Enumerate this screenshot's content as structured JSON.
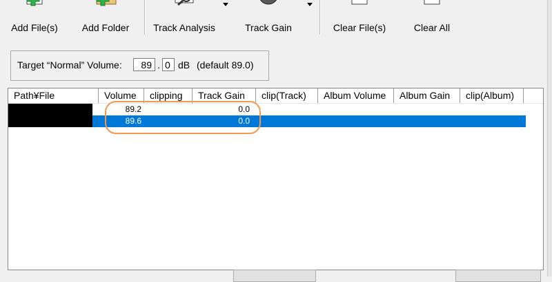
{
  "toolbar": {
    "buttons": [
      {
        "label": "Add File(s)",
        "icon": "add-file-icon"
      },
      {
        "label": "Add Folder",
        "icon": "add-folder-icon"
      },
      {
        "label": "Track Analysis",
        "icon": "analysis-magnifier-icon"
      },
      {
        "label": "Track Gain",
        "icon": "gain-speaker-icon"
      },
      {
        "label": "Clear File(s)",
        "icon": "clear-file-icon"
      },
      {
        "label": "Clear All",
        "icon": "clear-all-icon"
      }
    ]
  },
  "target": {
    "label": "Target “Normal” Volume:",
    "value_int": "89",
    "dot": ".",
    "value_dec": "0",
    "unit": "dB",
    "default": "(default 89.0)"
  },
  "list": {
    "columns": [
      "Path¥File",
      "Volume",
      "clipping",
      "Track Gain",
      "clip(Track)",
      "Album Volume",
      "Album Gain",
      "clip(Album)"
    ],
    "rows": [
      {
        "volume": "89.2",
        "track_gain": "0.0",
        "selected": false
      },
      {
        "volume": "89.6",
        "track_gain": "0.0",
        "selected": true
      }
    ]
  },
  "colors": {
    "selection": "#0078d7",
    "highlight": "#f39a4f"
  }
}
